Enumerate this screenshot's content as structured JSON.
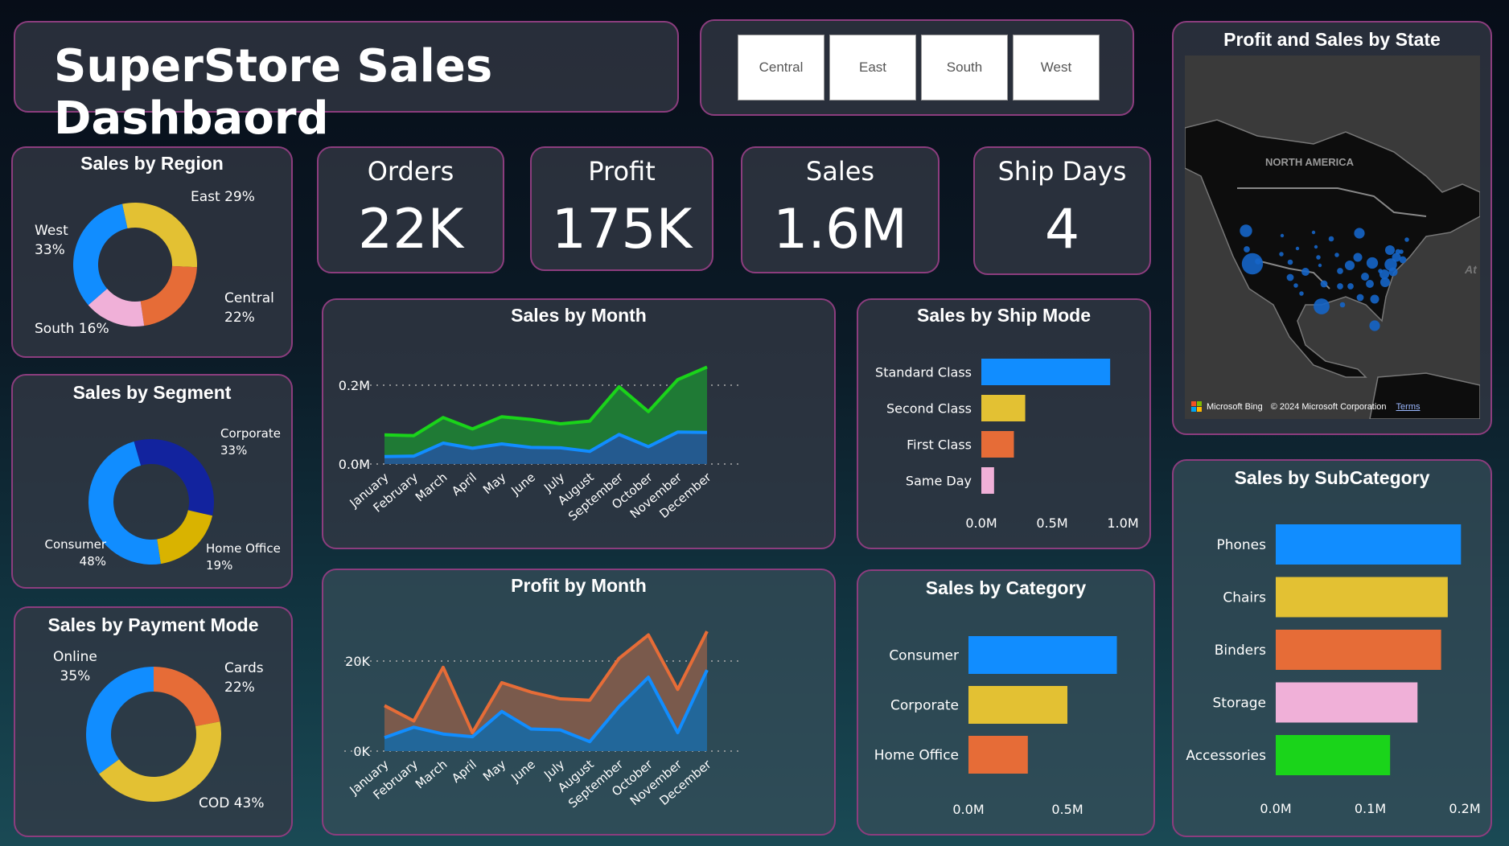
{
  "title": "SuperStore Sales Dashbaord",
  "region_filter": [
    "Central",
    "East",
    "South",
    "West"
  ],
  "kpis": [
    {
      "label": "Orders",
      "value": "22K"
    },
    {
      "label": "Profit",
      "value": "175K"
    },
    {
      "label": "Sales",
      "value": "1.6M"
    },
    {
      "label": "Ship Days",
      "value": "4"
    }
  ],
  "colors": {
    "blue": "#118dff",
    "yellow": "#e3c133",
    "orange": "#e66c37",
    "pink": "#f0b0d8",
    "navy": "#12239e",
    "gold": "#d9b300",
    "green": "#1ad41a",
    "border": "#8c3d7e"
  },
  "sales_by_region": {
    "title": "Sales by Region",
    "slices": [
      {
        "name": "East",
        "pct": 29,
        "label": "East 29%",
        "color": "#e3c133"
      },
      {
        "name": "Central",
        "pct": 22,
        "label1": "Central",
        "label2": "22%",
        "color": "#e66c37"
      },
      {
        "name": "South",
        "pct": 16,
        "label": "South 16%",
        "color": "#f0b0d8"
      },
      {
        "name": "West",
        "pct": 33,
        "label1": "West",
        "label2": "33%",
        "color": "#118dff"
      }
    ]
  },
  "sales_by_segment": {
    "title": "Sales by Segment",
    "slices": [
      {
        "name": "Corporate",
        "pct": 33,
        "label2": "33%",
        "color": "#12239e"
      },
      {
        "name": "Home Office",
        "pct": 19,
        "label2": "19%",
        "color": "#d9b300"
      },
      {
        "name": "Consumer",
        "pct": 48,
        "label2": "48%",
        "color": "#118dff"
      }
    ]
  },
  "sales_by_payment": {
    "title": "Sales by Payment Mode",
    "slices": [
      {
        "name": "Cards",
        "pct": 22,
        "label2": "22%",
        "color": "#e66c37"
      },
      {
        "name": "COD",
        "pct": 43,
        "label": "COD 43%",
        "color": "#e3c133"
      },
      {
        "name": "Online",
        "pct": 35,
        "label2": "35%",
        "color": "#118dff"
      }
    ]
  },
  "map": {
    "title": "Profit and Sales by State",
    "region_label": "NORTH AMERICA",
    "ocean_label": "At",
    "brand": "Microsoft Bing",
    "copyright": "© 2024 Microsoft Corporation",
    "terms": "Terms"
  },
  "chart_data": [
    {
      "type": "area",
      "title": "Sales by Month",
      "categories": [
        "January",
        "February",
        "March",
        "April",
        "May",
        "June",
        "July",
        "August",
        "September",
        "October",
        "November",
        "December"
      ],
      "yticks": [
        "0.0M",
        "0.2M"
      ],
      "ylim": [
        0,
        0.2
      ],
      "grid": true,
      "series": [
        {
          "color": "#1ad41a",
          "fill": "#1f7a35",
          "values": [
            0.074,
            0.072,
            0.118,
            0.089,
            0.12,
            0.113,
            0.102,
            0.109,
            0.196,
            0.133,
            0.214,
            0.246
          ]
        },
        {
          "color": "#118dff",
          "fill": "#245a8f",
          "values": [
            0.019,
            0.02,
            0.053,
            0.04,
            0.051,
            0.042,
            0.041,
            0.032,
            0.075,
            0.044,
            0.081,
            0.08
          ]
        }
      ]
    },
    {
      "type": "area",
      "title": "Profit by Month",
      "categories": [
        "January",
        "February",
        "March",
        "April",
        "May",
        "June",
        "July",
        "August",
        "September",
        "October",
        "November",
        "December"
      ],
      "yticks": [
        "0K",
        "20K"
      ],
      "ylim": [
        0,
        20000
      ],
      "grid": true,
      "series": [
        {
          "color": "#e66c37",
          "fill": "#7a5a4c",
          "values": [
            10100,
            6700,
            18600,
            4100,
            15200,
            13100,
            11600,
            11300,
            20600,
            25800,
            13700,
            26600
          ]
        },
        {
          "color": "#118dff",
          "fill": "#22679a",
          "values": [
            3000,
            5300,
            3800,
            3200,
            8800,
            4900,
            4700,
            2100,
            9900,
            16400,
            4100,
            18000
          ]
        }
      ]
    },
    {
      "type": "bar",
      "title": "Sales by Ship Mode",
      "categories": [
        "Standard Class",
        "Second Class",
        "First Class",
        "Same Day"
      ],
      "values": [
        0.91,
        0.31,
        0.23,
        0.09
      ],
      "colors": [
        "#118dff",
        "#e3c133",
        "#e66c37",
        "#f0b0d8"
      ],
      "xticks": [
        "0.0M",
        "0.5M",
        "1.0M"
      ],
      "xlim": [
        0,
        1.0
      ]
    },
    {
      "type": "bar",
      "title": "Sales by Category",
      "categories": [
        "Consumer",
        "Corporate",
        "Home Office"
      ],
      "values": [
        0.75,
        0.5,
        0.3
      ],
      "colors": [
        "#118dff",
        "#e3c133",
        "#e66c37"
      ],
      "xticks": [
        "0.0M",
        "0.5M"
      ],
      "xlim": [
        0,
        0.5
      ]
    },
    {
      "type": "bar",
      "title": "Sales by SubCategory",
      "categories": [
        "Phones",
        "Chairs",
        "Binders",
        "Storage",
        "Accessories"
      ],
      "values": [
        0.196,
        0.182,
        0.175,
        0.15,
        0.121
      ],
      "colors": [
        "#118dff",
        "#e3c133",
        "#e66c37",
        "#f0b0d8",
        "#1ad41a"
      ],
      "xticks": [
        "0.0M",
        "0.1M",
        "0.2M"
      ],
      "xlim": [
        0,
        0.2
      ]
    }
  ]
}
